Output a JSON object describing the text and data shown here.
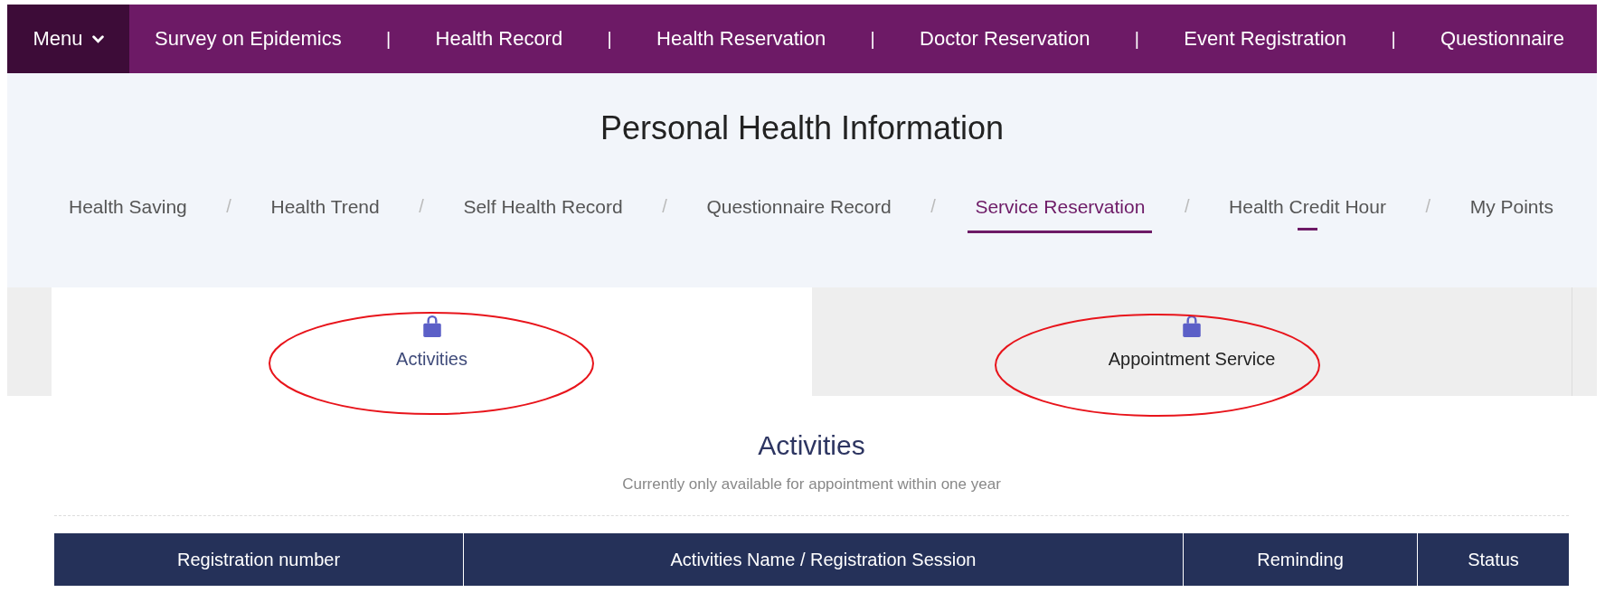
{
  "top_nav": {
    "menu_label": "Menu",
    "separator": "|",
    "items": [
      {
        "label": "Survey on Epidemics"
      },
      {
        "label": "Health Record"
      },
      {
        "label": "Health Reservation"
      },
      {
        "label": "Doctor Reservation"
      },
      {
        "label": "Event Registration"
      },
      {
        "label": "Questionnaire"
      }
    ]
  },
  "page_title": "Personal Health Information",
  "breadcrumb_tabs": {
    "separator": "/",
    "items": [
      {
        "label": "Health Saving",
        "selected": false,
        "hovered": false
      },
      {
        "label": "Health Trend",
        "selected": false,
        "hovered": false
      },
      {
        "label": "Self Health Record",
        "selected": false,
        "hovered": false
      },
      {
        "label": "Questionnaire Record",
        "selected": false,
        "hovered": false
      },
      {
        "label": "Service Reservation",
        "selected": true,
        "hovered": false
      },
      {
        "label": "Health Credit Hour",
        "selected": false,
        "hovered": true
      },
      {
        "label": "My Points",
        "selected": false,
        "hovered": false
      }
    ]
  },
  "service_tabs": [
    {
      "label": "Activities",
      "selected": true,
      "circled": true
    },
    {
      "label": "Appointment Service",
      "selected": false,
      "circled": true
    }
  ],
  "section": {
    "title": "Activities",
    "subtitle": "Currently only available for appointment within one year"
  },
  "table": {
    "columns": [
      "Registration number",
      "Activities Name / Registration Session",
      "Reminding",
      "Status"
    ]
  }
}
